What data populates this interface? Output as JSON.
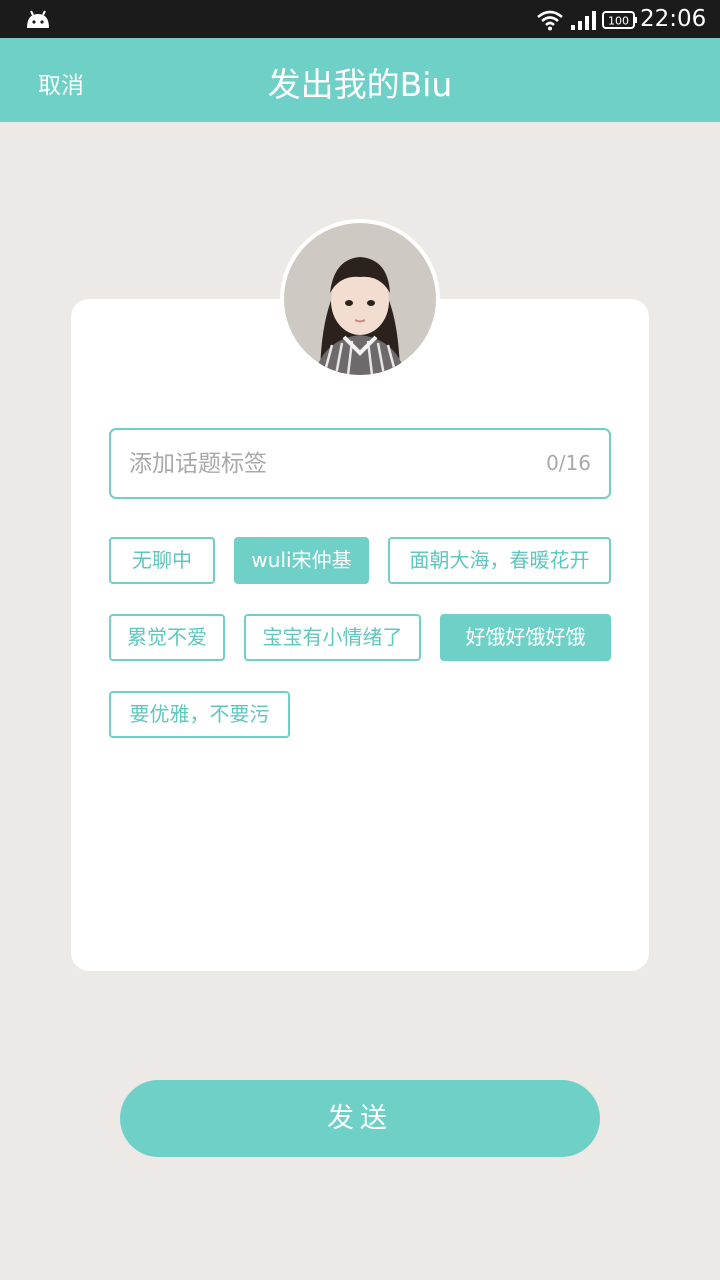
{
  "status_bar": {
    "time": "22:06",
    "battery": "100"
  },
  "header": {
    "cancel_label": "取消",
    "title": "发出我的Biu"
  },
  "topic": {
    "placeholder": "添加话题标签",
    "counter": "0/16"
  },
  "tags": [
    {
      "label": "无聊中",
      "selected": false
    },
    {
      "label": "wuli宋仲基",
      "selected": true
    },
    {
      "label": "面朝大海，春暖花开",
      "selected": false
    },
    {
      "label": "累觉不爱",
      "selected": false
    },
    {
      "label": "宝宝有小情绪了",
      "selected": false
    },
    {
      "label": "好饿好饿好饿",
      "selected": true
    },
    {
      "label": "要优雅，不要污",
      "selected": false
    }
  ],
  "send_label": "发送",
  "colors": {
    "accent": "#6fd0c7",
    "background": "#ede9e6",
    "status_bar": "#1b1b1b"
  }
}
